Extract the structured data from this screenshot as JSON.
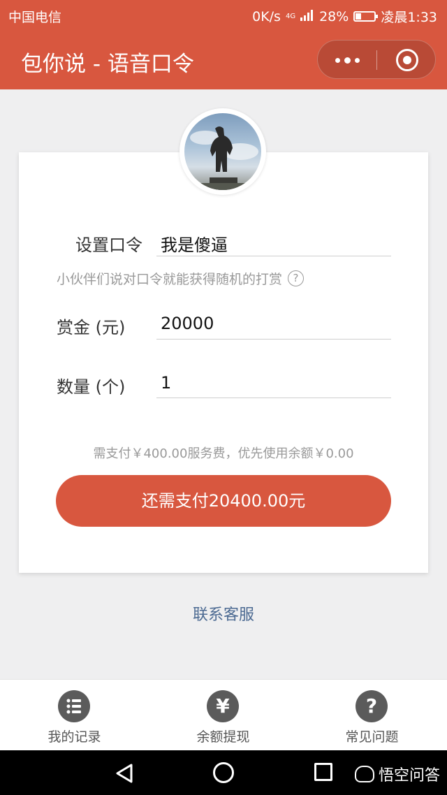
{
  "status_bar": {
    "carrier": "中国电信",
    "speed": "0K/s",
    "network": "4G",
    "battery": "28%",
    "time": "凌晨1:33",
    "battery_level": 0.28
  },
  "nav": {
    "title": "包你说 - 语音口令"
  },
  "form": {
    "password_label": "设置口令",
    "password_value": "我是傻逼",
    "hint": "小伙伴们说对口令就能获得随机的打赏",
    "help_symbol": "?",
    "amount_label": "赏金 (元)",
    "amount_value": "20000",
    "count_label": "数量 (个)",
    "count_value": "1",
    "fee_text": "需支付￥400.00服务费，优先使用余额￥0.00",
    "pay_button": "还需支付20400.00元"
  },
  "contact_link": "联系客服",
  "tabs": [
    {
      "label": "我的记录",
      "icon": "list-icon",
      "symbol": ""
    },
    {
      "label": "余额提现",
      "icon": "yuan-icon",
      "symbol": "¥"
    },
    {
      "label": "常见问题",
      "icon": "question-icon",
      "symbol": "?"
    }
  ],
  "watermark": "悟空问答",
  "colors": {
    "accent": "#d8573f",
    "link": "#4c6a92",
    "background": "#efeff0"
  }
}
